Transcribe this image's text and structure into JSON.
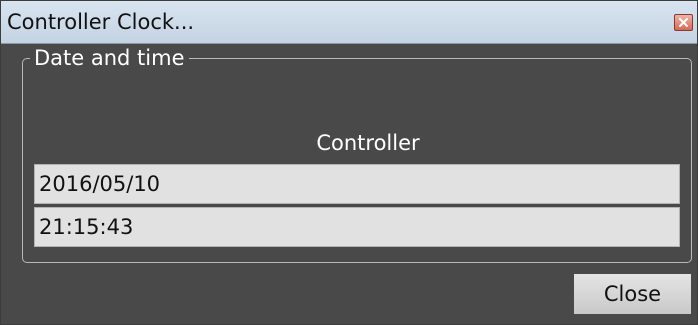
{
  "window": {
    "title": "Controller Clock..."
  },
  "group": {
    "legend": "Date and time",
    "column_header": "Controller",
    "date_value": "2016/05/10",
    "time_value": "21:15:43"
  },
  "buttons": {
    "close_label": "Close"
  },
  "icons": {
    "title_close": "close-icon"
  },
  "colors": {
    "client_background": "#494949",
    "titlebar": "#c4d3e3",
    "field_background": "#e1e1e1",
    "close_icon": "#d86a55"
  }
}
